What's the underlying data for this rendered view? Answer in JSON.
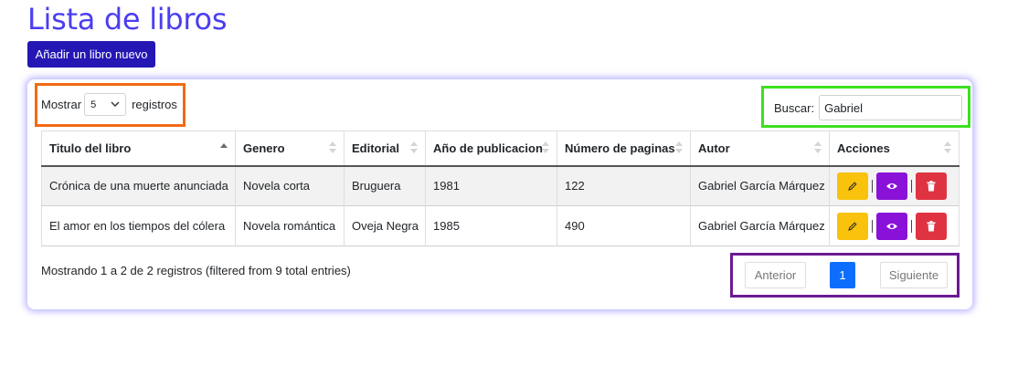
{
  "page": {
    "title": "Lista de libros",
    "add_button": "Añadir un libro nuevo"
  },
  "length": {
    "label_before": "Mostrar",
    "value": "5",
    "label_after": "registros"
  },
  "search": {
    "label": "Buscar:",
    "value": "Gabriel"
  },
  "table": {
    "columns": [
      "Titulo del libro",
      "Genero",
      "Editorial",
      "Año de publicacion",
      "Número de paginas",
      "Autor",
      "Acciones"
    ],
    "rows": [
      [
        "Crónica de una muerte anunciada",
        "Novela corta",
        "Bruguera",
        "1981",
        "122",
        "Gabriel García Márquez"
      ],
      [
        "El amor en los tiempos del cólera",
        "Novela romántica",
        "Oveja Negra",
        "1985",
        "490",
        "Gabriel García Márquez"
      ]
    ],
    "sorted_column": "Titulo del libro",
    "sort_direction": "asc"
  },
  "info": "Mostrando 1 a 2 de 2 registros (filtered from 9 total entries)",
  "pagination": {
    "previous": "Anterior",
    "current": "1",
    "next": "Siguiente"
  },
  "colors": {
    "title": "#4a3ef0",
    "add_button": "#2417b4",
    "edit": "#f8c20d",
    "view": "#8a12d8",
    "delete": "#e03342",
    "page_active": "#0d6efd",
    "highlight_length": "#f26a14",
    "highlight_search": "#3ee020",
    "highlight_pagination": "#6c1a93"
  },
  "icons": {
    "edit": "pencil-icon",
    "view": "eye-icon",
    "delete": "trash-icon"
  }
}
